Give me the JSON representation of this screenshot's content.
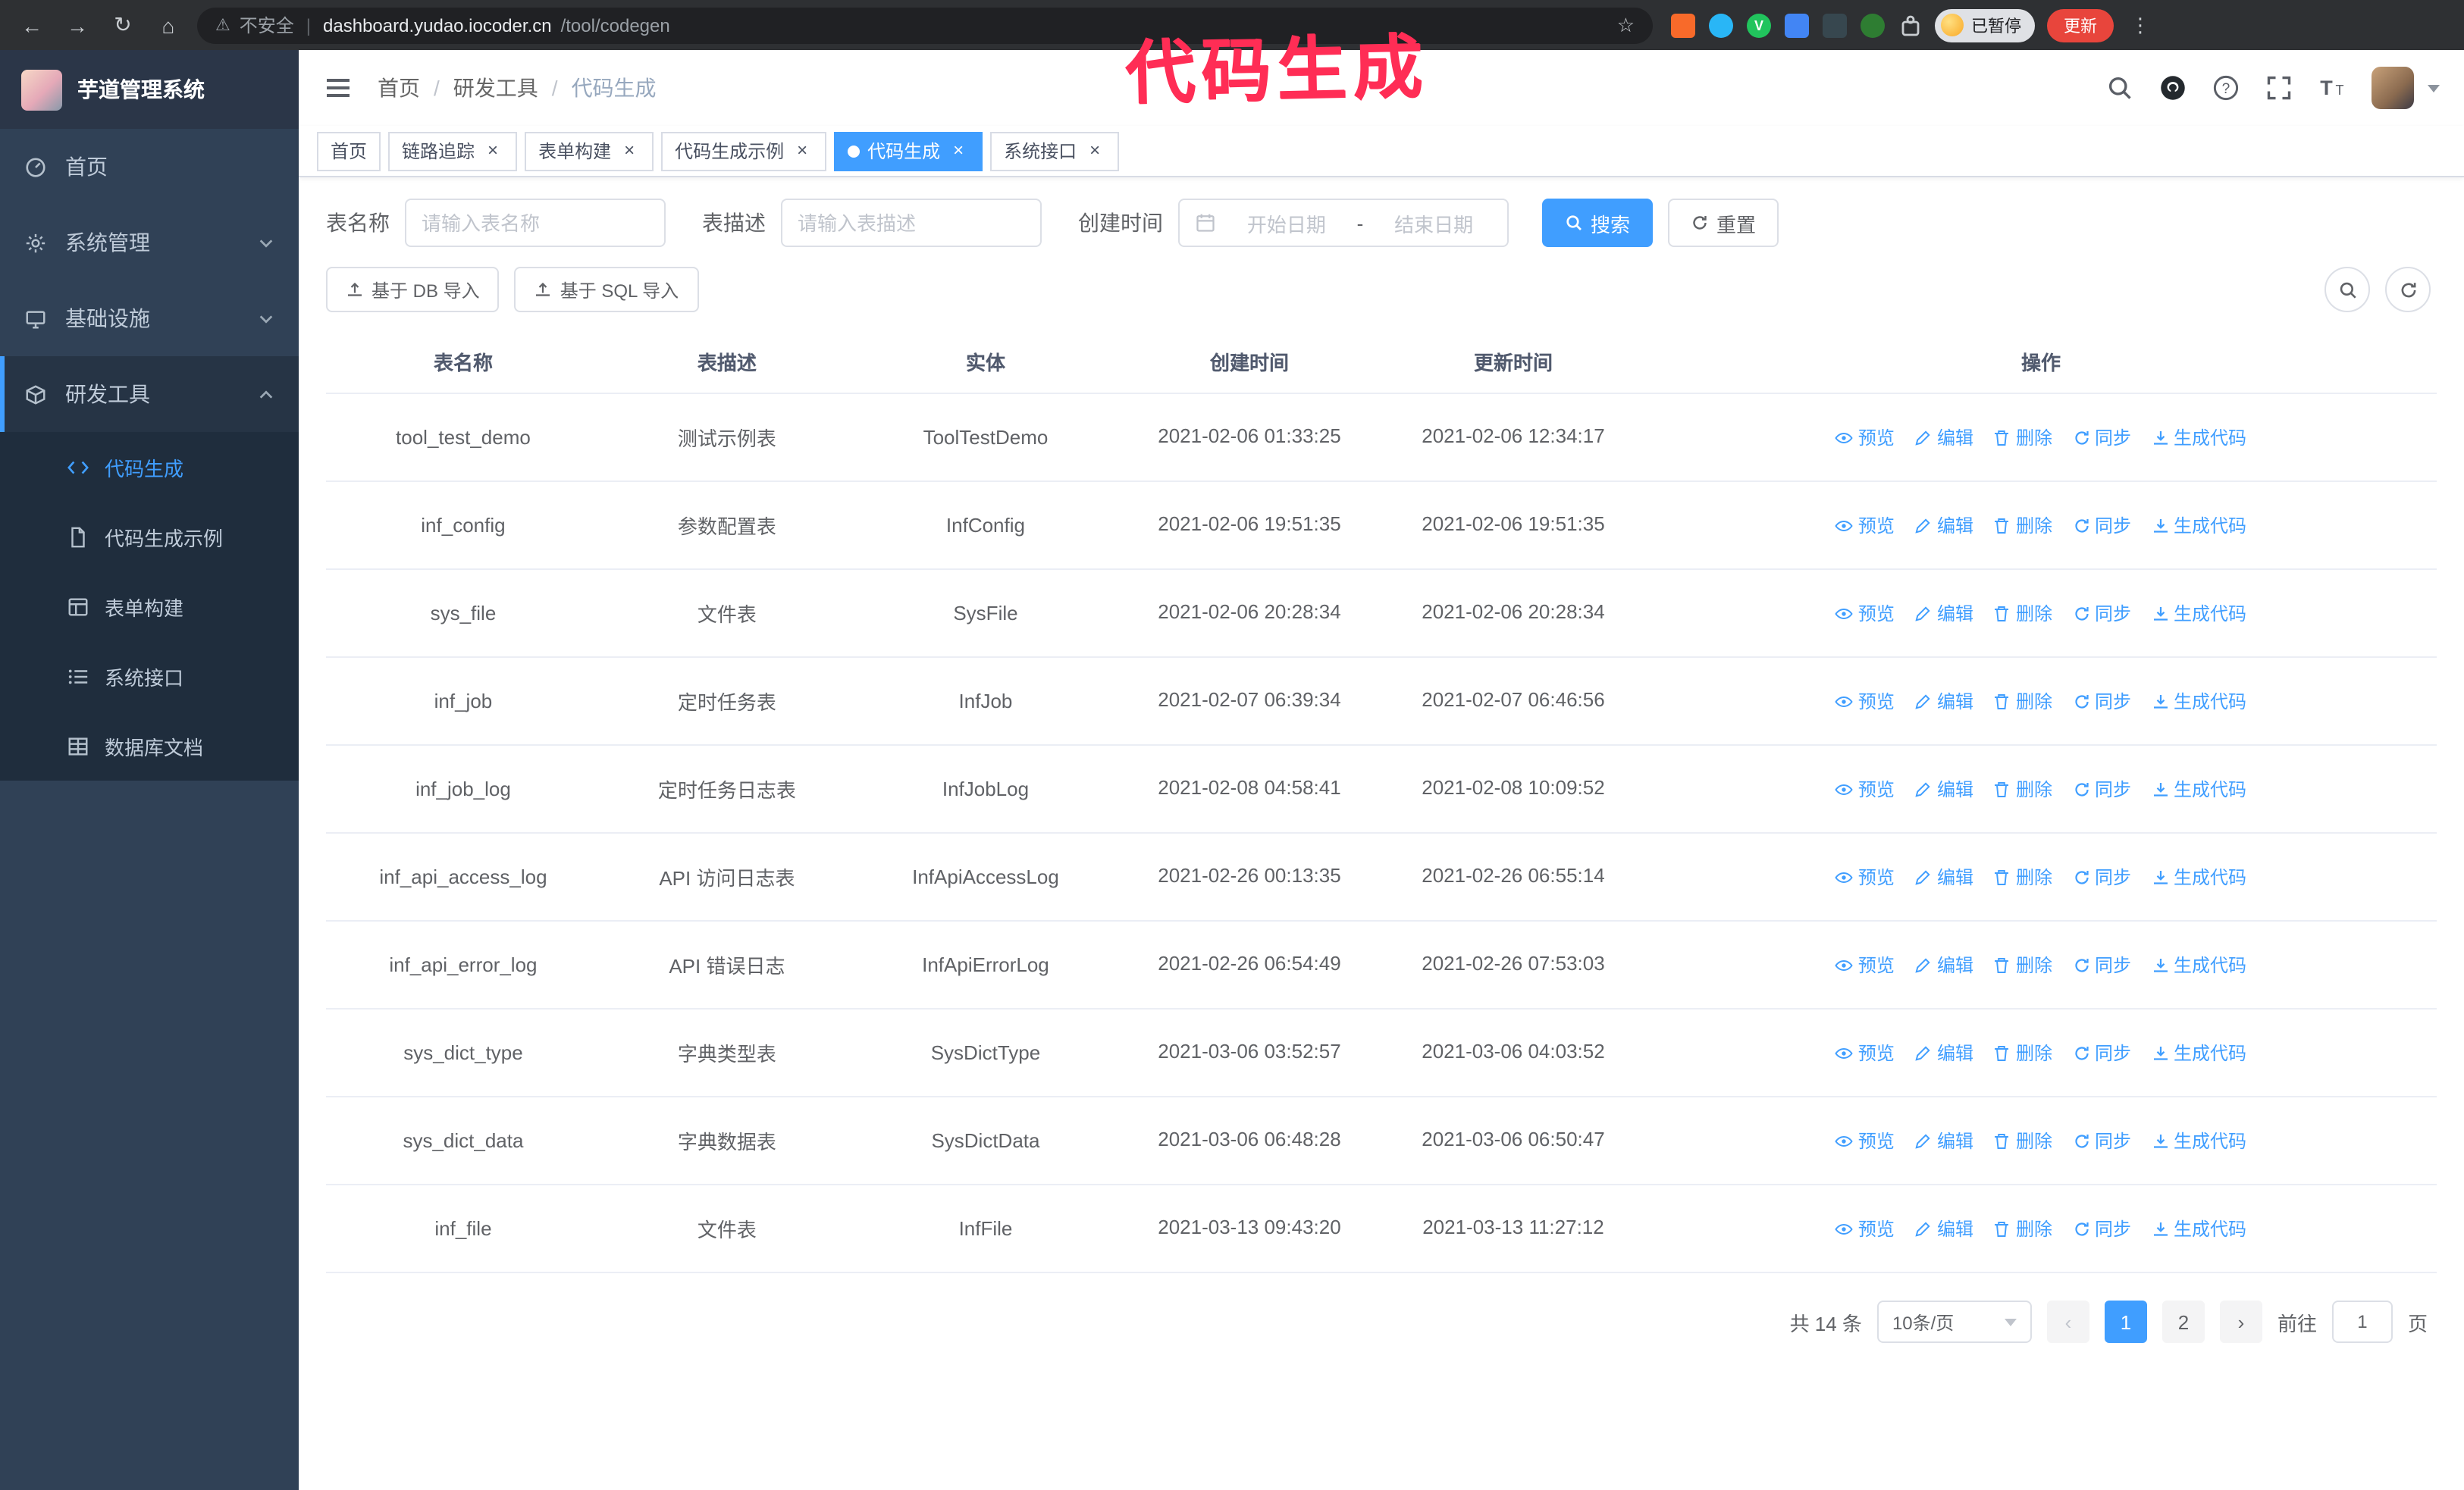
{
  "colors": {
    "accent": "#409eff",
    "sidebar_bg": "#304156",
    "submenu_bg": "#1f2d3d",
    "active_tab_bg": "#409eff",
    "annotation": "#ff2d55",
    "update_button_bg": "#e8453c"
  },
  "icons": {
    "back": "←",
    "forward": "→",
    "reload": "↻",
    "home": "⌂",
    "warning": "⚠",
    "star": "☆",
    "kebab": "⋮",
    "close": "×",
    "prev": "‹",
    "next": "›",
    "divider": "|",
    "vue_badge": "V"
  },
  "browser": {
    "security_label": "不安全",
    "url_host": "dashboard.yudao.iocoder.cn",
    "url_path": "/tool/codegen",
    "profile_chip": "已暂停",
    "update_button": "更新"
  },
  "annotation": {
    "text": "代码生成"
  },
  "sidebar": {
    "title": "芋道管理系统",
    "items": [
      {
        "label": "首页"
      },
      {
        "label": "系统管理"
      },
      {
        "label": "基础设施"
      },
      {
        "label": "研发工具"
      }
    ],
    "submenu": [
      {
        "label": "代码生成",
        "active": true
      },
      {
        "label": "代码生成示例"
      },
      {
        "label": "表单构建"
      },
      {
        "label": "系统接口"
      },
      {
        "label": "数据库文档"
      }
    ]
  },
  "header": {
    "breadcrumb": [
      "首页",
      "研发工具",
      "代码生成"
    ],
    "separator": "/"
  },
  "tabs": [
    {
      "label": "首页",
      "closable": false
    },
    {
      "label": "链路追踪",
      "closable": true
    },
    {
      "label": "表单构建",
      "closable": true
    },
    {
      "label": "代码生成示例",
      "closable": true
    },
    {
      "label": "代码生成",
      "closable": true,
      "active": true
    },
    {
      "label": "系统接口",
      "closable": true
    }
  ],
  "filters": {
    "table_name_label": "表名称",
    "table_name_placeholder": "请输入表名称",
    "table_desc_label": "表描述",
    "table_desc_placeholder": "请输入表描述",
    "create_time_label": "创建时间",
    "date_start_placeholder": "开始日期",
    "date_separator": "-",
    "date_end_placeholder": "结束日期",
    "search_button": "搜索",
    "reset_button": "重置"
  },
  "toolbar": {
    "import_db": "基于 DB 导入",
    "import_sql": "基于 SQL 导入"
  },
  "table": {
    "columns": [
      "表名称",
      "表描述",
      "实体",
      "创建时间",
      "更新时间",
      "操作"
    ],
    "actions": [
      "预览",
      "编辑",
      "删除",
      "同步",
      "生成代码"
    ],
    "rows": [
      {
        "name": "tool_test_demo",
        "desc": "测试示例表",
        "entity": "ToolTestDemo",
        "created": "2021-02-06 01:33:25",
        "updated": "2021-02-06 12:34:17"
      },
      {
        "name": "inf_config",
        "desc": "参数配置表",
        "entity": "InfConfig",
        "created": "2021-02-06 19:51:35",
        "updated": "2021-02-06 19:51:35"
      },
      {
        "name": "sys_file",
        "desc": "文件表",
        "entity": "SysFile",
        "created": "2021-02-06 20:28:34",
        "updated": "2021-02-06 20:28:34"
      },
      {
        "name": "inf_job",
        "desc": "定时任务表",
        "entity": "InfJob",
        "created": "2021-02-07 06:39:34",
        "updated": "2021-02-07 06:46:56"
      },
      {
        "name": "inf_job_log",
        "desc": "定时任务日志表",
        "entity": "InfJobLog",
        "created": "2021-02-08 04:58:41",
        "updated": "2021-02-08 10:09:52"
      },
      {
        "name": "inf_api_access_log",
        "desc": "API 访问日志表",
        "entity": "InfApiAccessLog",
        "created": "2021-02-26 00:13:35",
        "updated": "2021-02-26 06:55:14"
      },
      {
        "name": "inf_api_error_log",
        "desc": "API 错误日志",
        "entity": "InfApiErrorLog",
        "created": "2021-02-26 06:54:49",
        "updated": "2021-02-26 07:53:03"
      },
      {
        "name": "sys_dict_type",
        "desc": "字典类型表",
        "entity": "SysDictType",
        "created": "2021-03-06 03:52:57",
        "updated": "2021-03-06 04:03:52"
      },
      {
        "name": "sys_dict_data",
        "desc": "字典数据表",
        "entity": "SysDictData",
        "created": "2021-03-06 06:48:28",
        "updated": "2021-03-06 06:50:47"
      },
      {
        "name": "inf_file",
        "desc": "文件表",
        "entity": "InfFile",
        "created": "2021-03-13 09:43:20",
        "updated": "2021-03-13 11:27:12"
      }
    ]
  },
  "pagination": {
    "total": "共 14 条",
    "page_size": "10条/页",
    "pages": [
      "1",
      "2"
    ],
    "active_page": "1",
    "goto_label": "前往",
    "goto_value": "1",
    "goto_suffix": "页"
  }
}
